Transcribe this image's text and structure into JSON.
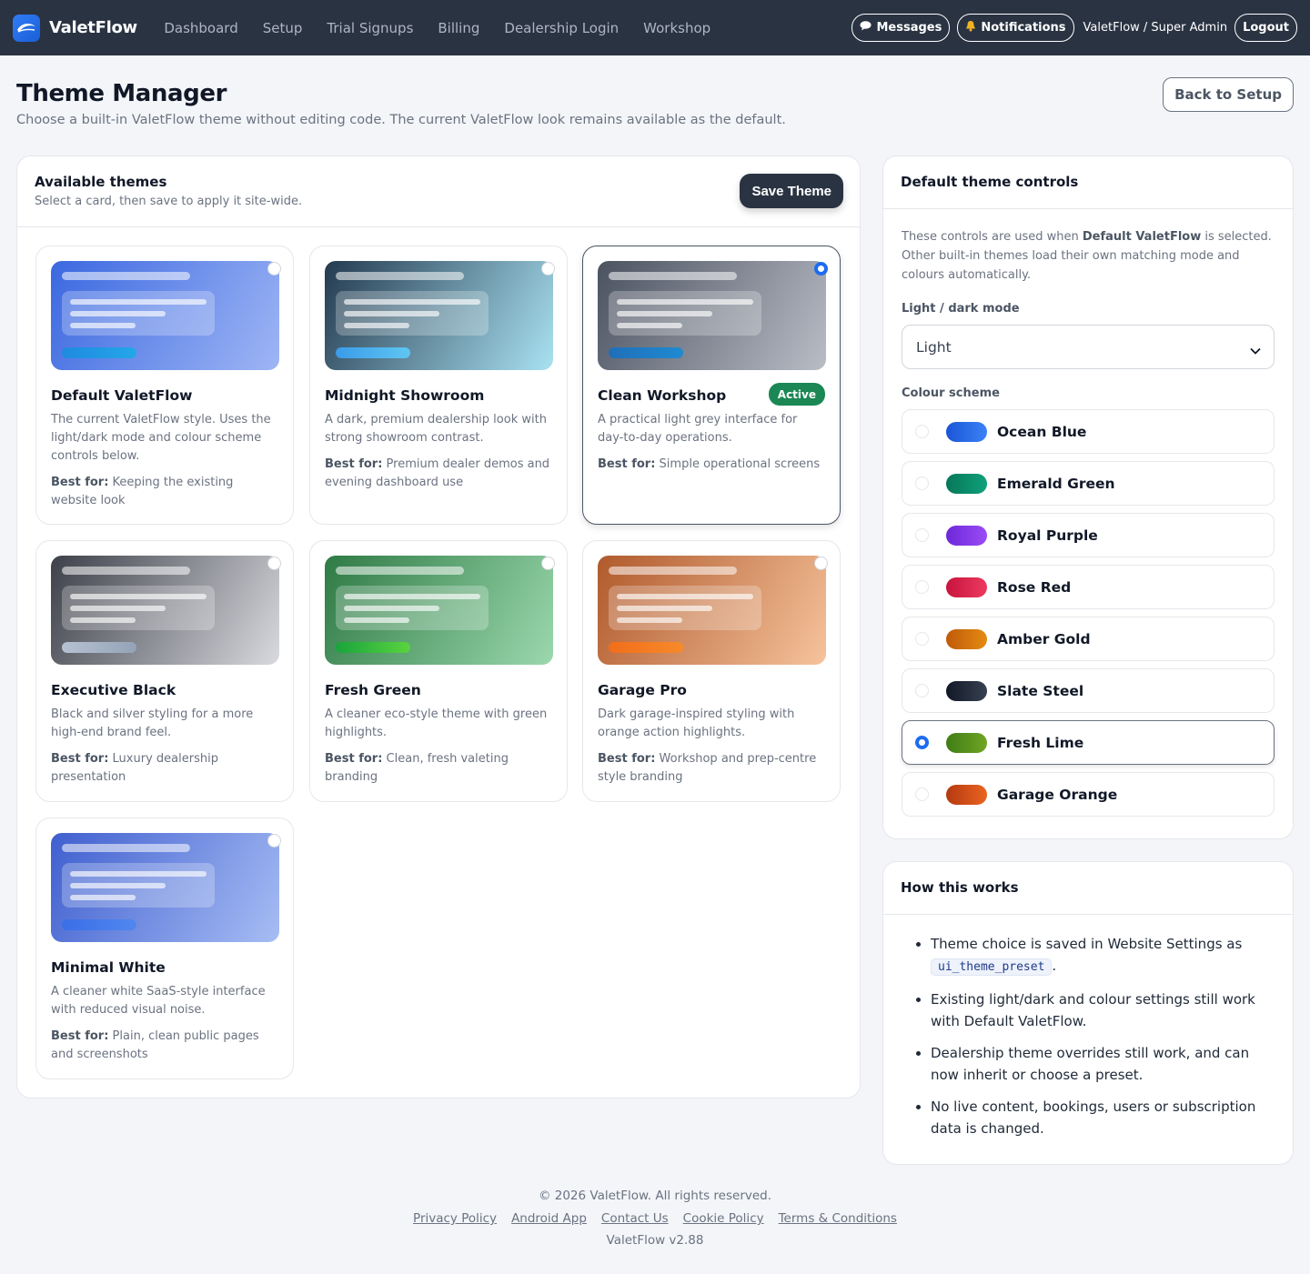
{
  "nav": {
    "brand": "ValetFlow",
    "links": [
      "Dashboard",
      "Setup",
      "Trial Signups",
      "Billing",
      "Dealership Login",
      "Workshop"
    ],
    "messages": "Messages",
    "notifications": "Notifications",
    "user": "ValetFlow / Super Admin",
    "logout": "Logout"
  },
  "page": {
    "title": "Theme Manager",
    "subtitle": "Choose a built-in ValetFlow theme without editing code. The current ValetFlow look remains available as the default.",
    "back_label": "Back to Setup"
  },
  "themes": {
    "title": "Available themes",
    "desc": "Select a card, then save to apply it site-wide.",
    "save_label": "Save Theme",
    "best_for_label": "Best for:",
    "active_label": "Active",
    "cards": [
      {
        "name": "Default ValetFlow",
        "desc": "The current ValetFlow style. Uses the light/dark mode and colour scheme controls below.",
        "best": "Keeping the existing website look",
        "bg": "linear-gradient(120deg,#3b68e0,#9fb6f5)",
        "pill": "linear-gradient(90deg,#1f8ae0,#23a7e8)",
        "selected": false
      },
      {
        "name": "Midnight Showroom",
        "desc": "A dark, premium dealership look with strong showroom contrast.",
        "best": "Premium dealer demos and evening dashboard use",
        "bg": "linear-gradient(120deg,#243a4f,#a9e2f2)",
        "pill": "linear-gradient(90deg,#3b9be8,#5fc6f2)",
        "selected": false
      },
      {
        "name": "Clean Workshop",
        "desc": "A practical light grey interface for day-to-day operations.",
        "best": "Simple operational screens",
        "bg": "linear-gradient(120deg,#4b5260,#b9bdc6)",
        "pill": "linear-gradient(90deg,#1f6fb8,#1f8ad2)",
        "selected": true
      },
      {
        "name": "Executive Black",
        "desc": "Black and silver styling for a more high-end brand feel.",
        "best": "Luxury dealership presentation",
        "bg": "linear-gradient(120deg,#3d4049,#d9dadf)",
        "pill": "linear-gradient(90deg,#b6c2d2,#94a3b8)",
        "selected": false
      },
      {
        "name": "Fresh Green",
        "desc": "A cleaner eco-style theme with green highlights.",
        "best": "Clean, fresh valeting branding",
        "bg": "linear-gradient(120deg,#2f7a45,#9bd8ad)",
        "pill": "linear-gradient(90deg,#19a43c,#5ad33f)",
        "selected": false
      },
      {
        "name": "Garage Pro",
        "desc": "Dark garage-inspired styling with orange action highlights.",
        "best": "Workshop and prep-centre style branding",
        "bg": "linear-gradient(120deg,#b05a2c,#f6c39c)",
        "pill": "linear-gradient(90deg,#f26d1a,#f78a2a)",
        "selected": false
      },
      {
        "name": "Minimal White",
        "desc": "A cleaner white SaaS-style interface with reduced visual noise.",
        "best": "Plain, clean public pages and screenshots",
        "bg": "linear-gradient(120deg,#3f5fcf,#a7bdf4)",
        "pill": "linear-gradient(90deg,#3a6ee8,#5087ee)",
        "selected": false
      }
    ]
  },
  "controls": {
    "title": "Default theme controls",
    "note_pre": "These controls are used when ",
    "note_bold": "Default ValetFlow",
    "note_post": " is selected. Other built-in themes load their own matching mode and colours automatically.",
    "mode_label": "Light / dark mode",
    "mode_value": "Light",
    "scheme_label": "Colour scheme",
    "schemes": [
      {
        "name": "Ocean Blue",
        "swatch": "linear-gradient(90deg,#1a55d6,#3b82f6)",
        "selected": false
      },
      {
        "name": "Emerald Green",
        "swatch": "linear-gradient(90deg,#06775a,#10a07a)",
        "selected": false
      },
      {
        "name": "Royal Purple",
        "swatch": "linear-gradient(90deg,#6d28d9,#9b4cf5)",
        "selected": false
      },
      {
        "name": "Rose Red",
        "swatch": "linear-gradient(90deg,#c8143e,#ec3a5f)",
        "selected": false
      },
      {
        "name": "Amber Gold",
        "swatch": "linear-gradient(90deg,#c05a09,#e38b12)",
        "selected": false
      },
      {
        "name": "Slate Steel",
        "swatch": "linear-gradient(90deg,#111827,#374151)",
        "selected": false
      },
      {
        "name": "Fresh Lime",
        "swatch": "linear-gradient(90deg,#3f7d16,#6fa524)",
        "selected": true
      },
      {
        "name": "Garage Orange",
        "swatch": "linear-gradient(90deg,#b53a11,#ea6320)",
        "selected": false
      }
    ]
  },
  "how": {
    "title": "How this works",
    "item1_pre": "Theme choice is saved in Website Settings as ",
    "item1_code": "ui_theme_preset",
    "item1_post": ".",
    "item2": "Existing light/dark and colour settings still work with Default ValetFlow.",
    "item3": "Dealership theme overrides still work, and can now inherit or choose a preset.",
    "item4": "No live content, bookings, users or subscription data is changed."
  },
  "footer": {
    "copyright": "© 2026 ValetFlow. All rights reserved.",
    "links": [
      "Privacy Policy",
      "Android App",
      "Contact Us",
      "Cookie Policy",
      "Terms & Conditions"
    ],
    "version": "ValetFlow v2.88"
  }
}
